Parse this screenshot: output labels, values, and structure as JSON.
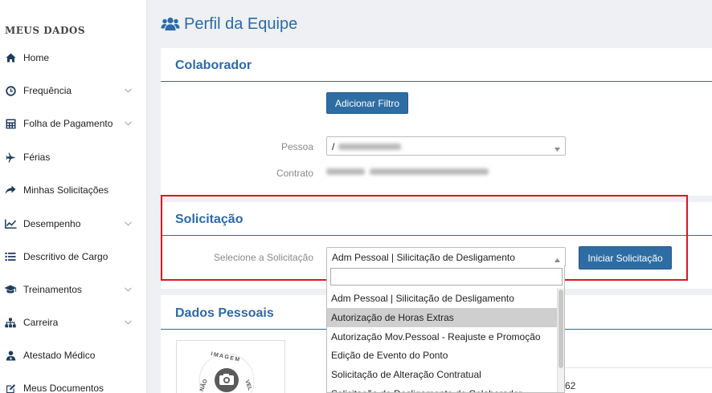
{
  "sidebar": {
    "title": "MEUS DADOS",
    "items": [
      {
        "label": "Home",
        "icon": "home-icon",
        "has_chevron": false
      },
      {
        "label": "Frequência",
        "icon": "clock-icon",
        "has_chevron": true
      },
      {
        "label": "Folha de Pagamento",
        "icon": "calculator-icon",
        "has_chevron": true
      },
      {
        "label": "Férias",
        "icon": "plane-icon",
        "has_chevron": false
      },
      {
        "label": "Minhas Solicitações",
        "icon": "share-arrow-icon",
        "has_chevron": false
      },
      {
        "label": "Desempenho",
        "icon": "line-chart-icon",
        "has_chevron": true
      },
      {
        "label": "Descritivo de Cargo",
        "icon": "list-icon",
        "has_chevron": false
      },
      {
        "label": "Treinamentos",
        "icon": "graduation-cap-icon",
        "has_chevron": true
      },
      {
        "label": "Carreira",
        "icon": "sitemap-icon",
        "has_chevron": true
      },
      {
        "label": "Atestado Médico",
        "icon": "user-md-icon",
        "has_chevron": false
      },
      {
        "label": "Meus Documentos",
        "icon": "edit-icon",
        "has_chevron": false
      }
    ]
  },
  "header": {
    "title": "Perfil da Equipe",
    "icon": "users-icon"
  },
  "colaborador": {
    "title": "Colaborador",
    "add_filter_label": "Adicionar Filtro",
    "pessoa_label": "Pessoa",
    "pessoa_value": "/",
    "contrato_label": "Contrato"
  },
  "solicitacao": {
    "title": "Solicitação",
    "select_label": "Selecione a Solicitação",
    "select_value": "Adm Pessoal | Silicitação de Desligamento",
    "start_button_label": "Iniciar Solicitação",
    "options": [
      "Adm Pessoal | Silicitação de Desligamento",
      "Autorização de Horas Extras",
      "Autorização Mov.Pessoal - Reajuste e Promoção",
      "Edição de Evento do Ponto",
      "Solicitação de Alteração Contratual",
      "Solicitação de Desligamento de Colaborador"
    ],
    "highlighted_index": 1
  },
  "dados_pessoais": {
    "title": "Dados Pessoais",
    "photo_text_top": "IMAGEM",
    "photo_text_left": "NÃO",
    "photo_text_right": "VEL",
    "partial_value": "62"
  },
  "colors": {
    "accent": "#2c6aa8",
    "button": "#2e6da4",
    "highlight_box": "#e0141e"
  }
}
